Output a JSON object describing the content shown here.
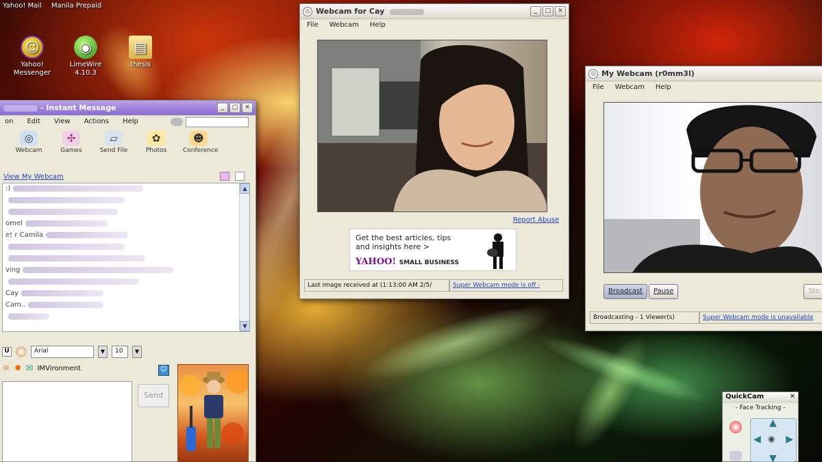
{
  "desktop": {
    "taskbar_items": [
      "Yahoo! Mail",
      "Manila Prepaid"
    ],
    "icons": [
      {
        "label": "Yahoo! Messenger",
        "icon": "yahoo-messenger-icon"
      },
      {
        "label": "LimeWire 4.10.3",
        "icon": "limewire-icon"
      },
      {
        "label": "thesis",
        "icon": "folder-icon"
      }
    ]
  },
  "im_window": {
    "title": "- Instant Message",
    "menu": [
      "on",
      "Edit",
      "View",
      "Actions",
      "Help"
    ],
    "toolbar": [
      {
        "label": "Webcam",
        "icon": "webcam-icon"
      },
      {
        "label": "Games",
        "icon": "games-icon"
      },
      {
        "label": "Send File",
        "icon": "send-file-icon"
      },
      {
        "label": "Photos",
        "icon": "photos-icon"
      },
      {
        "label": "Conference",
        "icon": "conference-icon"
      }
    ],
    "view_webcam_link": "View My Webcam",
    "chat_lines": [
      "",
      "",
      "",
      "",
      "",
      "",
      "",
      "",
      "",
      "",
      "",
      ""
    ],
    "chat_prefixes": [
      ":)",
      "",
      "",
      "",
      "e!",
      "",
      "",
      "ving",
      "",
      "Cay",
      "",
      ""
    ],
    "chat_visible": [
      "",
      "",
      "",
      "omel",
      "r Camila",
      "",
      "",
      "",
      "",
      "",
      "Cam..",
      ""
    ],
    "font_name": "Arial",
    "font_size": "10",
    "imvironment_label": "IMVironment",
    "send_label": "Send"
  },
  "webcam_friend": {
    "title": "Webcam for Cay",
    "menu": [
      "File",
      "Webcam",
      "Help"
    ],
    "report_abuse": "Report Abuse",
    "ad_text_1": "Get the best articles, tips",
    "ad_text_2": "and insights here >",
    "ad_brand": "YAHOO!",
    "ad_brand_suffix": "SMALL BUSINESS",
    "status_left": "Last image received at (1:13:00 AM 2/5/",
    "status_right": "Super Webcam mode is off -"
  },
  "my_webcam": {
    "title": "My Webcam (r0mm3l)",
    "menu": [
      "File",
      "Webcam",
      "Help"
    ],
    "broadcast_label": "Broadcast",
    "pause_label": "Pause",
    "status_left": "Broadcasting - 1 Viewer(s)",
    "status_right": "Super Webcam mode is unavailable",
    "partial_button": "Sto"
  },
  "quickcam": {
    "title": "QuickCam",
    "subtitle": "- Face Tracking -"
  },
  "colors": {
    "im_title": "#8a6ad2",
    "link": "#2244cc",
    "window_bg": "#ece9d8"
  }
}
